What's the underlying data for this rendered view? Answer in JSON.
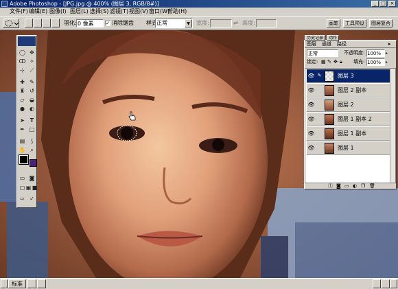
{
  "window": {
    "title": "Adobe Photoshop - [JPG.jpg @ 400% (图层 3, RGB/8#)]"
  },
  "menu": [
    "文件(F)",
    "编辑(E)",
    "图像(I)",
    "图层(L)",
    "选择(S)",
    "滤镜(T)",
    "视图(V)",
    "窗口(W)",
    "帮助(H)"
  ],
  "options": {
    "feather_label": "羽化:",
    "feather_value": "0 像素",
    "antialias_label": "消除锯齿",
    "style_label": "样式:",
    "style_value": "正常",
    "width_label": "宽度:",
    "height_label": "高度:"
  },
  "palette_well": {
    "tabs": [
      "画笔",
      "工具预设",
      "图层复合"
    ]
  },
  "layers_panel": {
    "top_tabs": [
      "历史记录",
      "动作"
    ],
    "tabs": [
      "图层",
      "通道",
      "路径"
    ],
    "blend_mode": "正常",
    "opacity_label": "不透明度:",
    "opacity_value": "100%",
    "lock_label": "锁定:",
    "fill_label": "填充:",
    "fill_value": "100%",
    "layers": [
      {
        "name": "图层 3",
        "selected": true
      },
      {
        "name": "图层 2 副本",
        "selected": false
      },
      {
        "name": "图层 2",
        "selected": false
      },
      {
        "name": "图层 1 副本 2",
        "selected": false
      },
      {
        "name": "图层 1 副本",
        "selected": false
      },
      {
        "name": "图层 1",
        "selected": false
      }
    ]
  },
  "statusbar": {
    "start_label": "标准"
  },
  "colors": {
    "title_gradient_start": "#0a246a",
    "title_gradient_end": "#3a6ea5",
    "selected_layer": "#0a246a",
    "foreground_color": "#000000",
    "background_color": "#4a1f78"
  }
}
